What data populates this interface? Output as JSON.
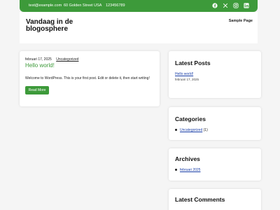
{
  "topbar": {
    "email": "test@example.com",
    "address": "60 Golden Street USA",
    "phone": "123456789",
    "icons": [
      "facebook-icon",
      "x-icon",
      "instagram-icon",
      "linkedin-icon"
    ]
  },
  "header": {
    "site_title": "Vandaag in de blogosphere",
    "nav": [
      "Sample Page"
    ]
  },
  "post": {
    "date": "februari 17, 2025",
    "category": "Uncategorized",
    "title": "Hello world!",
    "excerpt": "Welcome to WordPress. This is your first post. Edit or delete it, then start writing!",
    "read_more": "Read More"
  },
  "sidebar": {
    "latest_posts": {
      "title": "Latest Posts",
      "items": [
        {
          "label": "Hello world!",
          "date": "februari 17, 2025"
        }
      ]
    },
    "categories": {
      "title": "Categories",
      "items": [
        {
          "label": "Uncategorized",
          "count": "(1)"
        }
      ]
    },
    "archives": {
      "title": "Archives",
      "items": [
        {
          "label": "februari 2025"
        }
      ]
    },
    "latest_comments": {
      "title": "Latest Comments"
    }
  },
  "colors": {
    "accent": "#3d9a3a",
    "link": "#1a3fa8"
  }
}
